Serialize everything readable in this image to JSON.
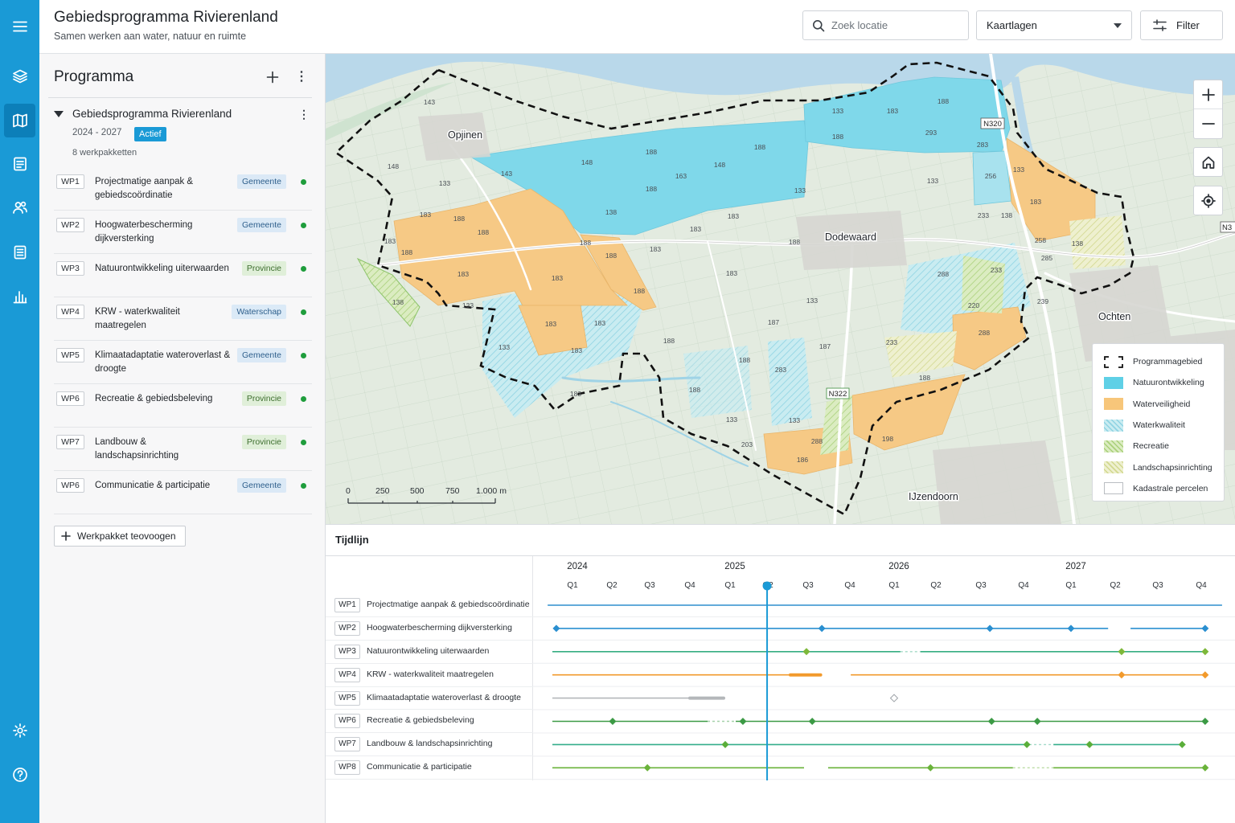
{
  "header": {
    "title": "Gebiedsprogramma Rivierenland",
    "subtitle": "Samen werken aan water, natuur en ruimte",
    "search_placeholder": "Zoek locatie",
    "layers_label": "Kaartlagen",
    "filter_label": "Filter"
  },
  "rail": {
    "items": [
      "menu-icon",
      "layers-icon",
      "map-icon",
      "table-icon",
      "users-icon",
      "document-icon",
      "chart-icon",
      "settings-icon",
      "help-icon"
    ],
    "active": "map-icon",
    "color": "#1a9ad6"
  },
  "panel": {
    "title": "Programma",
    "program": {
      "title": "Gebiedsprogramma Rivierenland",
      "period": "2024 - 2027",
      "status": "Actief",
      "count": "8 werkpakketten"
    },
    "items": [
      {
        "code": "WP1",
        "title": "Projectmatige aanpak & gebiedscoördinatie",
        "owner": "Gemeente"
      },
      {
        "code": "WP2",
        "title": "Hoogwaterbescherming dijkversterking",
        "owner": "Gemeente"
      },
      {
        "code": "WP3",
        "title": "Natuurontwikkeling uiterwaarden",
        "owner": "Provincie"
      },
      {
        "code": "WP4",
        "title": "KRW - waterkwaliteit maatregelen",
        "owner": "Waterschap"
      },
      {
        "code": "WP5",
        "title": "Klimaatadaptatie wateroverlast & droogte",
        "owner": "Gemeente"
      },
      {
        "code": "WP6",
        "title": "Recreatie & gebiedsbeleving",
        "owner": "Provincie"
      },
      {
        "code": "WP7",
        "title": "Landbouw & landschapsinrichting",
        "owner": "Provincie"
      },
      {
        "code": "WP6",
        "title": "Communicatie & participatie",
        "owner": "Gemeente"
      }
    ],
    "add_label": "Werkpakket teovoogen"
  },
  "map": {
    "places": {
      "opjinen": "Opjinen",
      "dodewaard": "Dodewaard",
      "ochten": "Ochten",
      "ijzendoorn": "IJzendoorn"
    },
    "roads": {
      "n320": "N320",
      "n322": "N322",
      "n3": "N3"
    },
    "parcel_labels": [
      "143",
      "148",
      "143",
      "133",
      "183",
      "188",
      "188",
      "183",
      "188",
      "183",
      "183",
      "133",
      "138",
      "148",
      "188",
      "163",
      "148",
      "188",
      "188",
      "183",
      "183",
      "138",
      "188",
      "188",
      "183",
      "188",
      "133",
      "188",
      "183",
      "183",
      "183",
      "183",
      "133",
      "188",
      "183",
      "187",
      "133",
      "188",
      "188",
      "283",
      "187",
      "233",
      "133",
      "183",
      "188",
      "293",
      "188",
      "283",
      "133",
      "256",
      "133",
      "183",
      "233",
      "138",
      "258",
      "285",
      "233",
      "288",
      "220",
      "288",
      "239",
      "138",
      "188",
      "133",
      "133",
      "203",
      "288",
      "186",
      "198"
    ],
    "scale": [
      "0",
      "250",
      "500",
      "750",
      "1.000 m"
    ],
    "controls": [
      "zoom-in-icon",
      "zoom-out-icon",
      "home-icon",
      "locate-icon"
    ],
    "legend": [
      {
        "label": "Programmagebied",
        "swatch": "dashed-outline"
      },
      {
        "label": "Natuurontwikkeling",
        "swatch": "#5fd0e6"
      },
      {
        "label": "Waterveiligheid",
        "swatch": "#f7c67a"
      },
      {
        "label": "Waterkwaliteit",
        "swatch": "hatched-light-blue"
      },
      {
        "label": "Recreatie",
        "swatch": "hatched-green"
      },
      {
        "label": "Landschapsinrichting",
        "swatch": "hatched-yellow-green"
      },
      {
        "label": "Kadastrale percelen",
        "swatch": "outline-gray"
      }
    ]
  },
  "timeline": {
    "title": "Tijdlijn",
    "years": [
      "2024",
      "2025",
      "2026",
      "2027"
    ],
    "quarters": [
      "Q1",
      "Q2",
      "Q3",
      "Q4",
      "Q1",
      "Q2",
      "Q3",
      "Q4",
      "Q1",
      "Q2",
      "Q3",
      "Q4",
      "Q1",
      "Q2",
      "Q3",
      "Q4"
    ],
    "now_quarter": 4.98,
    "now_color": "#1a9ad6",
    "rows": [
      {
        "code": "WP1",
        "label": "Projectmatige aanpak & gebiedscoördinatie",
        "color": "#2f8fce",
        "segments": [
          [
            -0.63,
            15.48
          ]
        ],
        "gaps": [],
        "bars": [],
        "milestones": [],
        "open_milestones": []
      },
      {
        "code": "WP2",
        "label": "Hoogwaterbescherming dijkversterking",
        "color": "#2a8fd0",
        "segments": [
          [
            -0.45,
            12.84
          ],
          [
            13.36,
            15.09
          ]
        ],
        "gaps": [],
        "bars": [],
        "milestones": [
          -0.41,
          6.33,
          10.21,
          12.0,
          15.09
        ],
        "open_milestones": []
      },
      {
        "code": "WP3",
        "label": "Natuurontwikkeling uiterwaarden",
        "color": "#36ad82",
        "segments": [
          [
            -0.51,
            8.15
          ],
          [
            8.63,
            15.09
          ]
        ],
        "gaps": [
          [
            8.15,
            8.63
          ]
        ],
        "bars": [],
        "milestones": [
          5.96,
          13.15,
          15.09
        ],
        "open_milestones": [],
        "milestone_color": "#7db83a"
      },
      {
        "code": "WP4",
        "label": "KRW - waterkwaliteit maatregelen",
        "color": "#f29a2c",
        "segments": [
          [
            -0.51,
            6.3
          ],
          [
            7.02,
            15.09
          ]
        ],
        "gaps": [],
        "bars": [
          [
            5.56,
            6.3
          ]
        ],
        "milestones": [
          13.15,
          15.09
        ],
        "open_milestones": []
      },
      {
        "code": "WP5",
        "label": "Klimaatadaptatie wateroverlast & droogte",
        "color": "#b4b7ba",
        "segments": [
          [
            -0.51,
            3.84
          ]
        ],
        "gaps": [],
        "bars": [
          [
            3.0,
            3.84
          ]
        ],
        "milestones": [],
        "open_milestones": [
          8.0
        ]
      },
      {
        "code": "WP6",
        "label": "Recreatie & gebiedsbeleving",
        "color": "#3c9a45",
        "segments": [
          [
            -0.51,
            3.44
          ],
          [
            4.15,
            15.09
          ]
        ],
        "gaps": [
          [
            3.44,
            4.15
          ]
        ],
        "bars": [],
        "milestones": [
          1.02,
          4.34,
          6.1,
          10.25,
          11.29,
          15.09
        ],
        "open_milestones": []
      },
      {
        "code": "WP7",
        "label": "Landbouw & landschapsinrichting",
        "color": "#34ae8a",
        "segments": [
          [
            -0.51,
            11.12
          ],
          [
            11.63,
            14.56
          ]
        ],
        "gaps": [
          [
            11.12,
            11.63
          ]
        ],
        "bars": [],
        "milestones": [
          3.88,
          11.07,
          12.42,
          14.56
        ],
        "open_milestones": [],
        "milestone_color": "#5aae3a"
      },
      {
        "code": "WP8",
        "label": "Communicatie & participatie",
        "color": "#6ab33a",
        "segments": [
          [
            -0.51,
            5.9
          ],
          [
            6.48,
            10.75
          ],
          [
            11.63,
            15.09
          ]
        ],
        "gaps": [
          [
            10.75,
            11.63
          ]
        ],
        "bars": [],
        "milestones": [
          1.94,
          8.87,
          15.09
        ],
        "open_milestones": []
      }
    ]
  }
}
